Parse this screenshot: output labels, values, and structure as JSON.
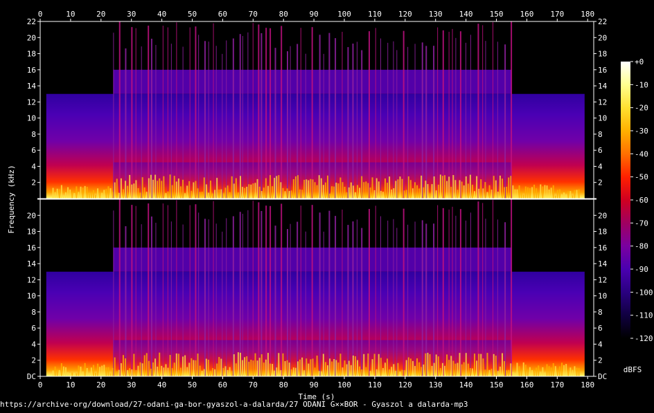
{
  "chart_data": {
    "type": "heatmap",
    "xlabel": "Time (s)",
    "ylabel": "Frequency (kHz)",
    "xlim": [
      0,
      182
    ],
    "ylim": [
      0,
      22
    ],
    "x_ticks": [
      0,
      10,
      20,
      30,
      40,
      50,
      60,
      70,
      80,
      90,
      100,
      110,
      120,
      130,
      140,
      150,
      160,
      170,
      180
    ],
    "y_ticks": [
      0,
      2,
      4,
      6,
      8,
      10,
      12,
      14,
      16,
      18,
      20,
      22
    ],
    "y_tick_labels_top": [
      "",
      "2",
      "4",
      "6",
      "8",
      "10",
      "12",
      "14",
      "16",
      "18",
      "20",
      "22"
    ],
    "y_tick_labels_bottom": [
      "DC",
      "2",
      "4",
      "6",
      "8",
      "10",
      "12",
      "14",
      "16",
      "18",
      "20",
      ""
    ],
    "channels": 2,
    "colorbar": {
      "label": "dBFS",
      "ticks": [
        0,
        -10,
        -20,
        -30,
        -40,
        -50,
        -60,
        -70,
        -80,
        -90,
        -100,
        -110,
        -120
      ],
      "tick_labels": [
        "+0",
        "-10",
        "-20",
        "-30",
        "-40",
        "-50",
        "-60",
        "-70",
        "-80",
        "-90",
        "-100",
        "-110",
        "-120"
      ],
      "colors": [
        "#ffffff",
        "#ffff90",
        "#ffe030",
        "#ffb000",
        "#ff7000",
        "#ff2000",
        "#d00020",
        "#a00060",
        "#7a00a0",
        "#4a00b0",
        "#2a0080",
        "#100040",
        "#000000"
      ]
    },
    "content": {
      "start_s": 2,
      "end_s": 179,
      "cutoff_khz": 13,
      "loud_section_start_s": 24,
      "loud_section_end_s": 155,
      "loud_cutoff_khz": 16
    }
  },
  "footer": {
    "source_text": "https://archive·org/download/27-odani-ga-bor-gyaszol-a-dalarda/27 ODANI G××BOR - Gyaszol a dalarda·mp3"
  }
}
